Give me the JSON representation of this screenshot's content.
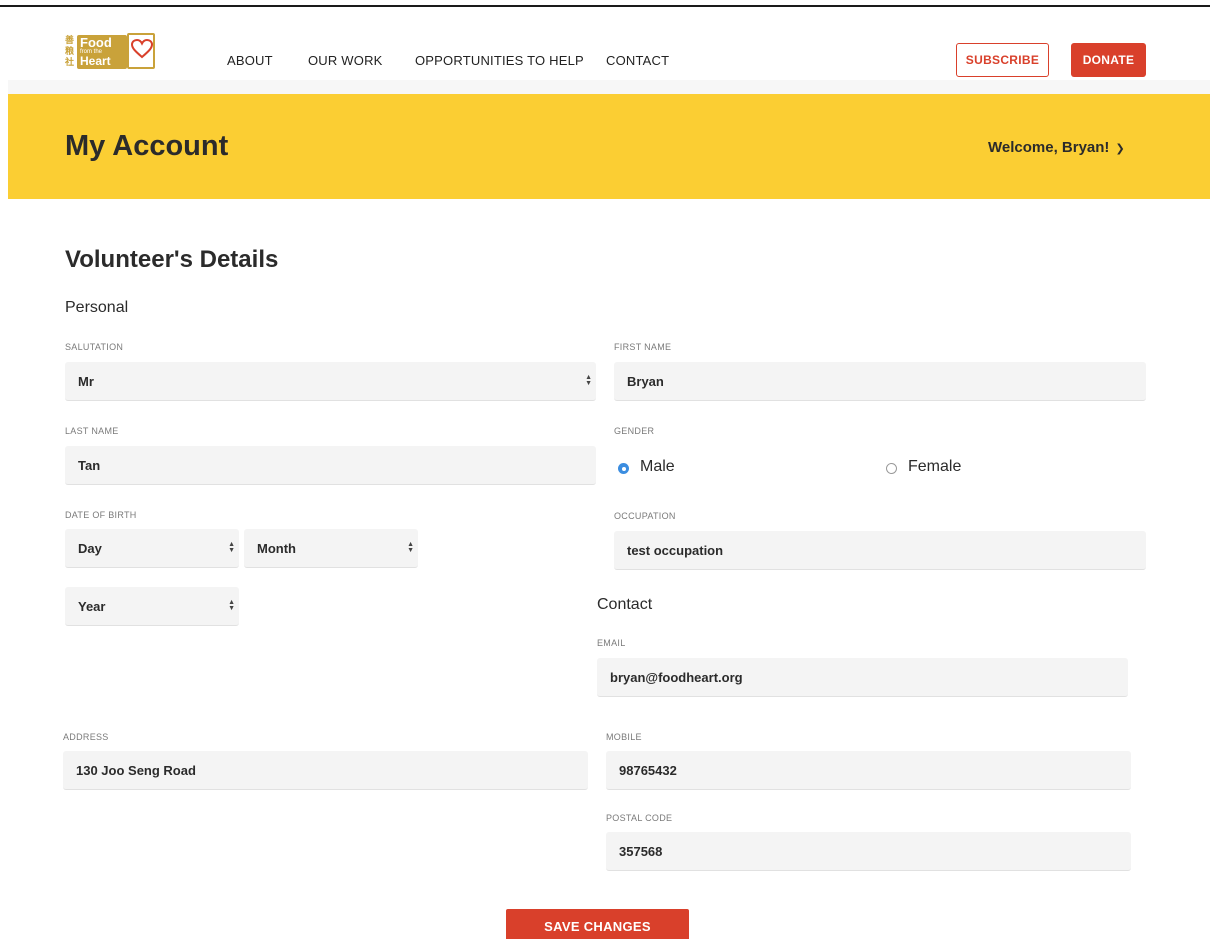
{
  "header": {
    "logo": {
      "cjk": "善粮社",
      "line1": "Food",
      "line2": "from the",
      "line3": "Heart"
    },
    "nav": [
      "ABOUT",
      "OUR WORK",
      "OPPORTUNITIES TO HELP",
      "CONTACT"
    ],
    "subscribe_label": "SUBSCRIBE",
    "donate_label": "DONATE"
  },
  "banner": {
    "title": "My Account",
    "welcome": "Welcome, Bryan!"
  },
  "form": {
    "heading": "Volunteer's Details",
    "personal_heading": "Personal",
    "contact_heading": "Contact",
    "salutation": {
      "label": "SALUTATION",
      "value": "Mr"
    },
    "first_name": {
      "label": "FIRST NAME",
      "value": "Bryan"
    },
    "last_name": {
      "label": "LAST NAME",
      "value": "Tan"
    },
    "gender": {
      "label": "GENDER",
      "options": [
        "Male",
        "Female"
      ],
      "selected": "Male"
    },
    "dob": {
      "label": "DATE OF BIRTH",
      "day": "Day",
      "month": "Month",
      "year": "Year"
    },
    "occupation": {
      "label": "OCCUPATION",
      "value": "test occupation"
    },
    "email": {
      "label": "EMAIL",
      "value": "bryan@foodheart.org"
    },
    "address": {
      "label": "ADDRESS",
      "value": "130 Joo Seng Road"
    },
    "mobile": {
      "label": "MOBILE",
      "value": "98765432"
    },
    "postal_code": {
      "label": "POSTAL CODE",
      "value": "357568"
    },
    "save_label": "SAVE CHANGES"
  },
  "colors": {
    "accent_red": "#d9402b",
    "banner_yellow": "#fbce33",
    "radio_blue": "#3b8de0",
    "logo_gold": "#c9a23a"
  }
}
